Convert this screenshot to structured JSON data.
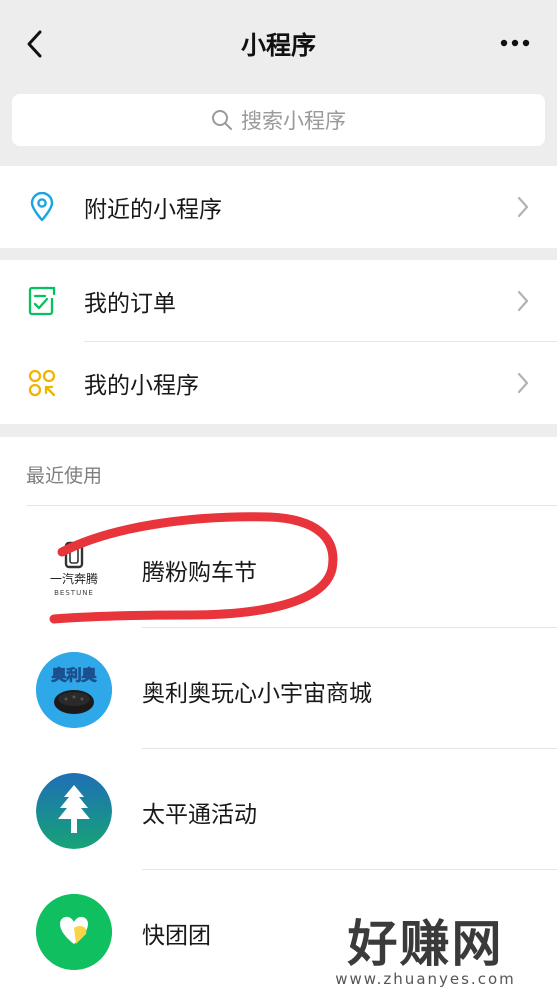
{
  "nav": {
    "title": "小程序"
  },
  "search": {
    "placeholder": "搜索小程序"
  },
  "nearby": {
    "label": "附近的小程序"
  },
  "orders": {
    "label": "我的订单"
  },
  "my_apps": {
    "label": "我的小程序"
  },
  "recent": {
    "header": "最近使用",
    "items": [
      {
        "name": "腾粉购车节",
        "logo_text": "一汽奔腾",
        "logo_sub": "BESTUNE"
      },
      {
        "name": "奥利奥玩心小宇宙商城",
        "logo_text": "奥利奥"
      },
      {
        "name": "太平通活动"
      },
      {
        "name": "快团团"
      }
    ]
  },
  "watermark": {
    "main": "好赚网",
    "url": "www.zhuanyes.com"
  },
  "colors": {
    "accent_green": "#07c160",
    "annotation_red": "#e8343b",
    "nearby_icon": "#1aa4e0",
    "apps_icon": "#f0b400"
  }
}
